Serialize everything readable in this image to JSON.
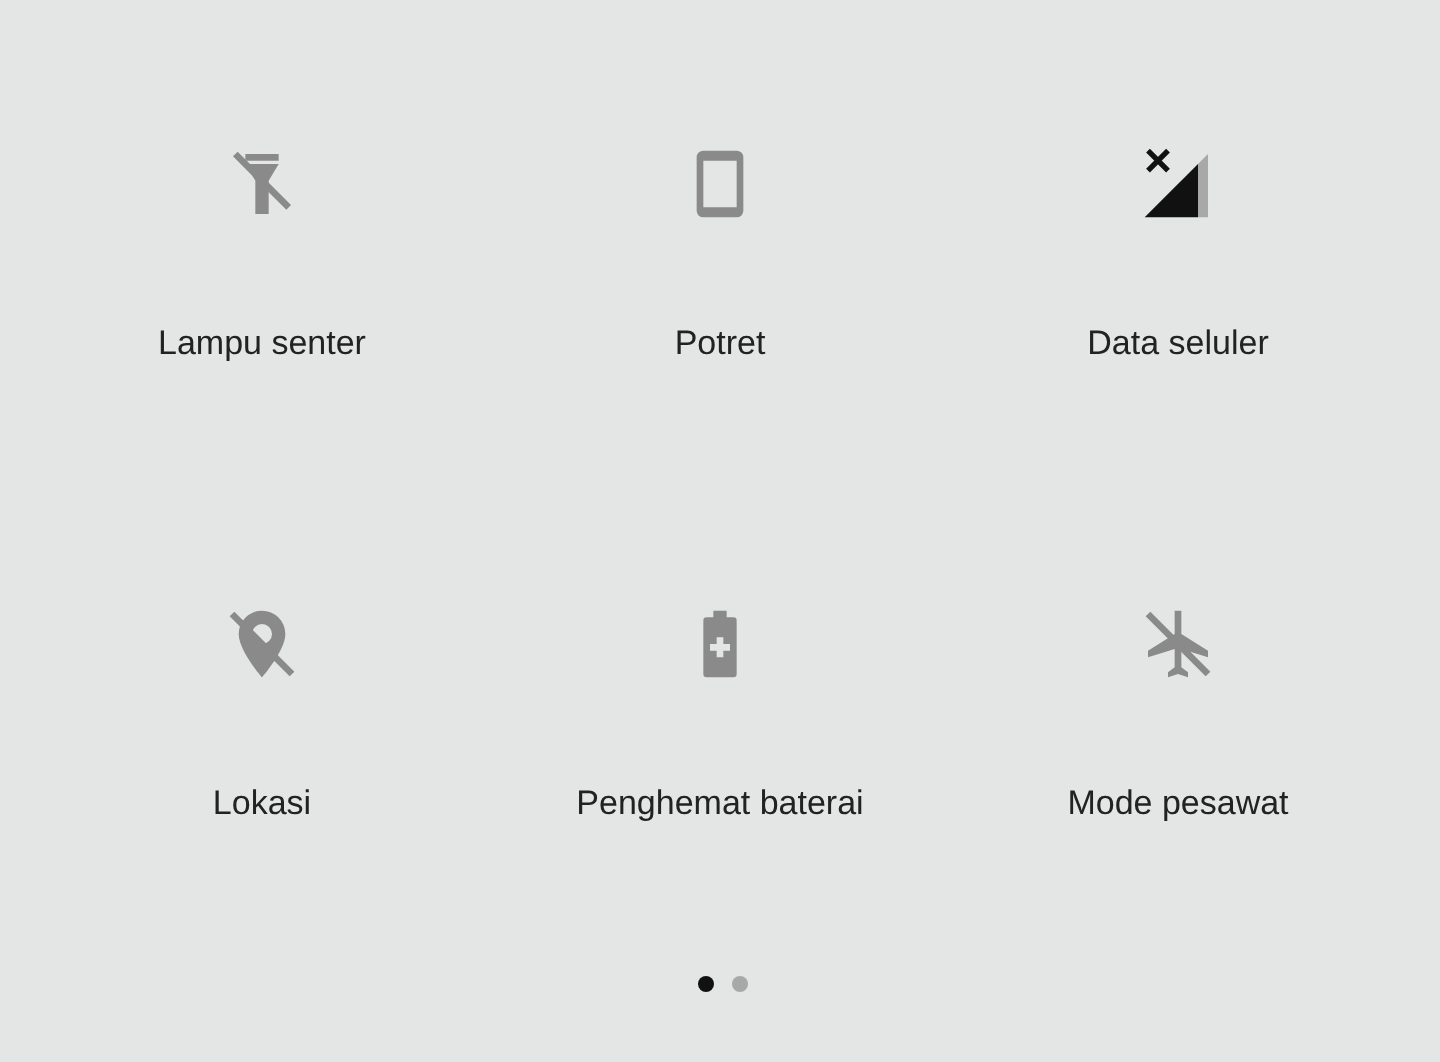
{
  "tiles": [
    {
      "kind": "flashlight",
      "label": "Lampu senter",
      "on": false
    },
    {
      "kind": "portrait",
      "label": "Potret",
      "on": false
    },
    {
      "kind": "cellular",
      "label": "Data seluler",
      "on": true
    },
    {
      "kind": "location",
      "label": "Lokasi",
      "on": false
    },
    {
      "kind": "battery_saver",
      "label": "Penghemat baterai",
      "on": false
    },
    {
      "kind": "airplane",
      "label": "Mode pesawat",
      "on": false
    }
  ],
  "pages": [
    {
      "selected": true
    },
    {
      "selected": false
    }
  ]
}
